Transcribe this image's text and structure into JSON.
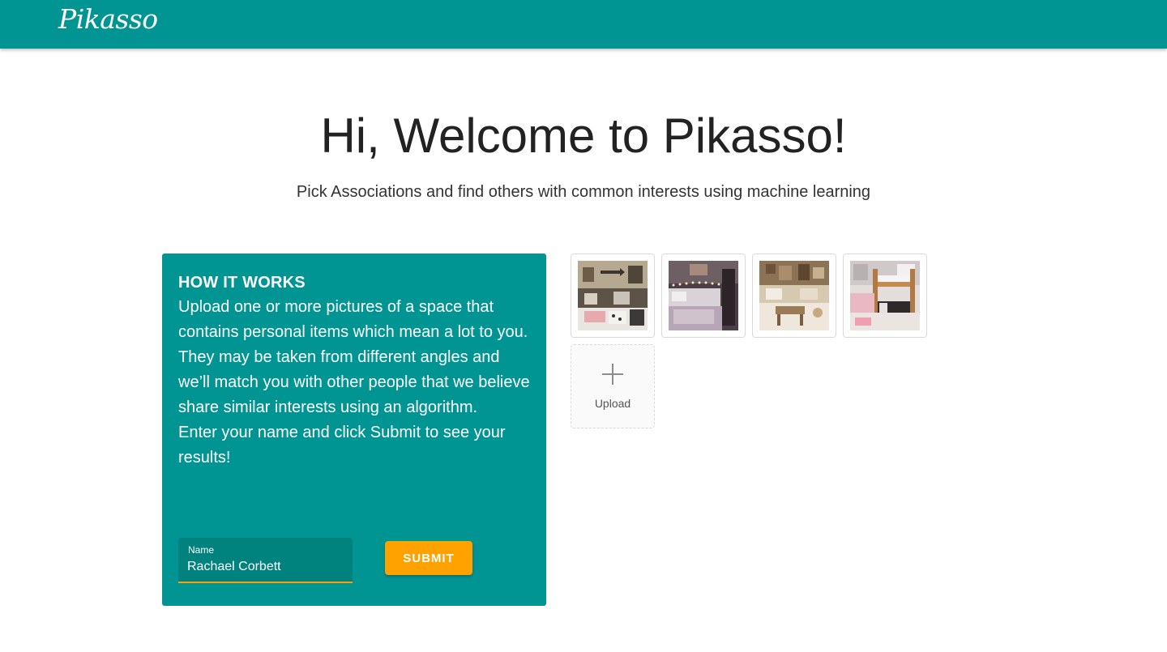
{
  "appbar": {
    "logo_text": "Pikasso",
    "background": "#009593"
  },
  "hero": {
    "title": "Hi, Welcome to Pikasso!",
    "subtitle": "Pick Associations and find others with common interests using machine learning"
  },
  "how_it_works": {
    "heading": "HOW IT WORKS",
    "paragraph_1": "Upload one or more pictures of a space that contains personal items which mean a lot to you. They may be taken from different angles and we’ll match you with other people that we believe share similar interests using an algorithm.",
    "paragraph_2": "Enter your name and click Submit to see your results!"
  },
  "form": {
    "name_label": "Name",
    "name_value": "Rachael Corbett",
    "submit_label": "SUBMIT",
    "accent": "#ffa200"
  },
  "uploads": {
    "thumbnails": [
      {
        "icon": "photo-room-1"
      },
      {
        "icon": "photo-room-2"
      },
      {
        "icon": "photo-room-3"
      },
      {
        "icon": "photo-room-4"
      }
    ],
    "upload_label": "Upload",
    "upload_icon": "plus-icon"
  }
}
